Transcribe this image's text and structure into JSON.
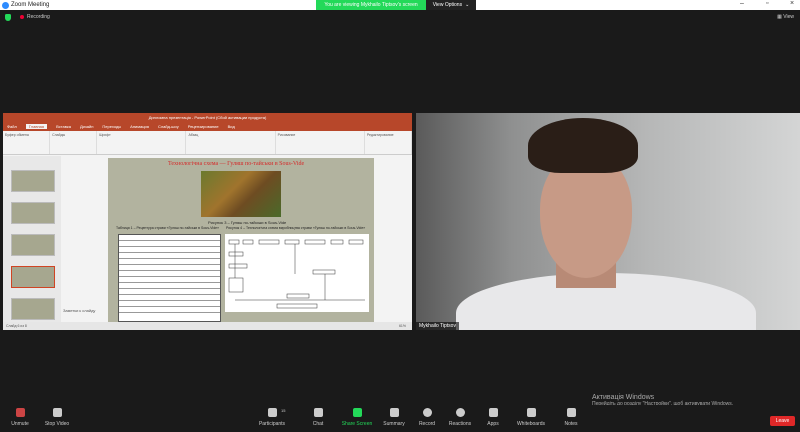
{
  "window": {
    "title": "Zoom Meeting",
    "banner": "You are viewing Mykhailo Tiptsov's screen",
    "view_options": "View Options"
  },
  "topbar": {
    "recording": "Recording",
    "view": "View"
  },
  "powerpoint": {
    "title": "Дипломна презентація - PowerPoint (Сбой активации продукта)",
    "tabs": [
      "Файл",
      "Главная",
      "Вставка",
      "Дизайн",
      "Переходы",
      "Анимация",
      "Слайд-шоу",
      "Рецензирование",
      "Вид"
    ],
    "ribbon_groups": [
      "Буфер обмена",
      "Слайды",
      "Шрифт",
      "Абзац",
      "Рисование",
      "Редактирование"
    ],
    "slide_heading": "Технологічна схема — Гуляш по-тайськи в Sous-Vide",
    "figure_caption": "Рисунок 3 – Гуляш по-тайськи в Sous-Vide",
    "table_caption": "Таблиця 1 – Рецептура страви «Гуляш по-тайськи в Sous-Vide»",
    "diagram_caption": "Рисунок 4 – Технологічна схема виробництва страви «Гуляш по-тайськи в Sous-Vide»",
    "notes": "Заметки к слайду",
    "status": "Слайд 6 из 8",
    "zoom": "61%"
  },
  "video": {
    "name": "Mykhailo Tiptsov"
  },
  "activation": {
    "title": "Активація Windows",
    "subtitle": "Перейдіть до розділу \"Настройки\", щоб активувати Windows."
  },
  "toolbar": {
    "unmute": "Unmute",
    "stop_video": "Stop Video",
    "participants": "Participants",
    "participants_count": "15",
    "chat": "Chat",
    "share": "Share Screen",
    "summary": "Summary",
    "record": "Record",
    "reactions": "Reactions",
    "apps": "Apps",
    "whiteboards": "Whiteboards",
    "notes": "Notes",
    "leave": "Leave"
  }
}
